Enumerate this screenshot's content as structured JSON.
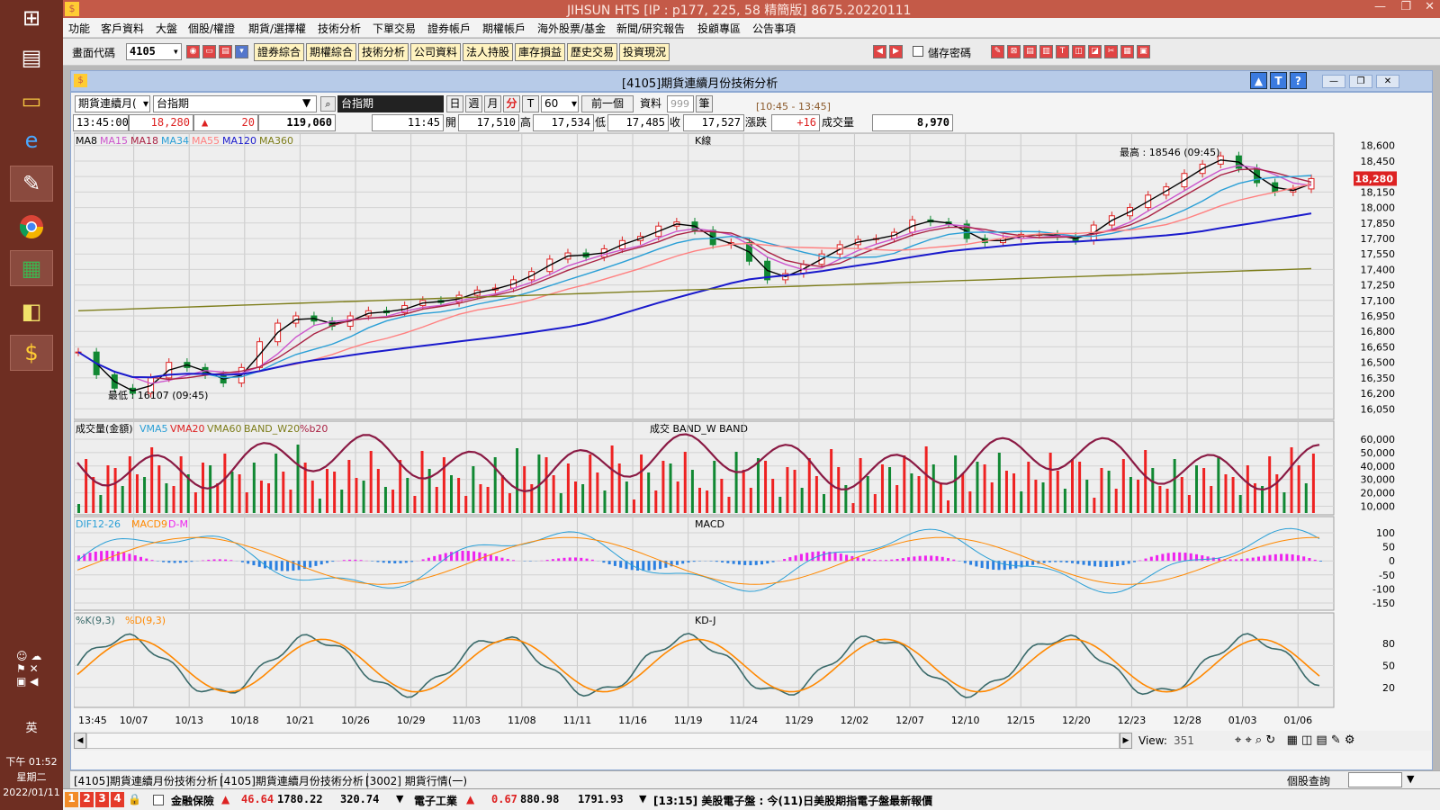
{
  "window_title": "JIHSUN HTS [IP : p177, 225, 58 精簡版] 8675.20220111",
  "taskbar": {
    "icons": [
      "windows-icon",
      "app-icon-1",
      "explorer-icon",
      "ie-icon",
      "paint-icon",
      "chrome-icon",
      "excel-icon",
      "sticky-icon",
      "jihsun-icon"
    ],
    "ime": "英",
    "time": "下午 01:52",
    "weekday": "星期二",
    "date": "2022/01/11"
  },
  "menu": [
    "功能",
    "客戶資料",
    "大盤",
    "個股/權證",
    "期貨/選擇權",
    "技術分析",
    "下單交易",
    "證券帳戶",
    "期權帳戶",
    "海外股票/基金",
    "新聞/研究報告",
    "投顧專區",
    "公告事項"
  ],
  "toolbar": {
    "code_label": "畫面代碼",
    "code_value": "4105",
    "buttons": [
      "證券綜合",
      "期權綜合",
      "技術分析",
      "公司資料",
      "法人持股",
      "庫存損益",
      "歷史交易",
      "投資現況"
    ],
    "save_password": "儲存密碼"
  },
  "child_window": {
    "title": "[4105]期貨連續月份技術分析",
    "dropdown_type": "期貨連續月(",
    "symbol": "台指期",
    "symbol_name": "台指期",
    "period_buttons": [
      "日",
      "週",
      "月",
      "分",
      "T"
    ],
    "minutes": "60",
    "prev": "前一個",
    "data_label": "資料",
    "data_count": "999",
    "data_unit": "筆",
    "session": "[10:45 - 13:45]"
  },
  "quote": {
    "time": "13:45:00",
    "price": "18,280",
    "change": "20",
    "volume_total": "119,060",
    "bar_time": "11:45",
    "open_label": "開",
    "open": "17,510",
    "high_label": "高",
    "high": "17,534",
    "low_label": "低",
    "low": "17,485",
    "close_label": "收",
    "close": "17,527",
    "chg_label": "漲跌",
    "chg": "+16",
    "vol_label": "成交量",
    "vol": "8,970"
  },
  "chart_data": {
    "type": "line",
    "panels": [
      "K線",
      "成交 BAND_W BAND",
      "MACD",
      "KD-J"
    ],
    "k_legend": [
      "MA8",
      "MA15",
      "MA18",
      "MA34",
      "MA55",
      "MA120",
      "MA360"
    ],
    "k_legend_colors": [
      "#000000",
      "#cc55cc",
      "#aa2244",
      "#2a9fd6",
      "#ff8080",
      "#1a1acc",
      "#7d7d1a"
    ],
    "high_annotation": "最高 : 18546 (09:45)",
    "low_annotation": "最低 : 16107 (09:45)",
    "price_ylim": [
      16000,
      18650
    ],
    "price_ticks": [
      "18,600",
      "18,450",
      "18,300",
      "18,150",
      "18,000",
      "17,850",
      "17,700",
      "17,550",
      "17,400",
      "17,250",
      "17,100",
      "16,950",
      "16,800",
      "16,650",
      "16,500",
      "16,350",
      "16,200",
      "16,050"
    ],
    "last_price": "18,280",
    "vol_legend": [
      "成交量(金額)",
      "VMA5",
      "VMA20",
      "VMA60",
      "BAND_W20",
      "%b20"
    ],
    "vol_legend_colors": [
      "#000000",
      "#2a9fd6",
      "#dd2222",
      "#7d7d1a",
      "#7d7d1a",
      "#aa2244"
    ],
    "vol_ticks": [
      "60,000",
      "50,000",
      "40,000",
      "30,000",
      "20,000",
      "10,000"
    ],
    "macd_legend": [
      "DIF12-26",
      "MACD9",
      "D-M"
    ],
    "macd_legend_colors": [
      "#2a9fd6",
      "#ff8800",
      "#ee22ee"
    ],
    "macd_ticks": [
      "100",
      "50",
      "0",
      "-50",
      "-100",
      "-150"
    ],
    "kd_legend": [
      "%K(9,3)",
      "%D(9,3)"
    ],
    "kd_legend_colors": [
      "#3a6a6a",
      "#ff8800"
    ],
    "kd_ticks": [
      "80",
      "50",
      "20"
    ],
    "x_ticks": [
      "13:45",
      "10/07",
      "10/13",
      "10/18",
      "10/21",
      "10/26",
      "10/29",
      "11/03",
      "11/08",
      "11/11",
      "11/16",
      "11/19",
      "11/24",
      "11/29",
      "12/02",
      "12/07",
      "12/10",
      "12/15",
      "12/20",
      "12/23",
      "12/28",
      "01/03",
      "01/06"
    ],
    "close_series": [
      16600,
      16380,
      16250,
      16200,
      16350,
      16500,
      16450,
      16380,
      16300,
      16450,
      16700,
      16880,
      16950,
      16900,
      16850,
      16950,
      17000,
      16980,
      17050,
      17100,
      17080,
      17150,
      17200,
      17220,
      17300,
      17380,
      17500,
      17560,
      17520,
      17600,
      17680,
      17720,
      17820,
      17860,
      17780,
      17640,
      17660,
      17480,
      17300,
      17360,
      17450,
      17550,
      17640,
      17690,
      17700,
      17760,
      17880,
      17860,
      17840,
      17700,
      17660,
      17700,
      17740,
      17740,
      17720,
      17680,
      17830,
      17920,
      18000,
      18120,
      18200,
      18330,
      18420,
      18500,
      18380,
      18240,
      18150,
      18180,
      18280
    ]
  },
  "scroll": {
    "view_label": "View:",
    "view": "351"
  },
  "status_tabs": [
    "[4105]期貨連續月份技術分析",
    "[4105]期貨連續月份技術分析",
    "[3002] 期貨行情(一)"
  ],
  "status_right": "個股查詢",
  "ticker": {
    "pages": [
      "1",
      "2",
      "3",
      "4"
    ],
    "item1_name": "金融保險",
    "item1_chg": "46.64",
    "item1_val": "1780.22",
    "item1_vol": "320.74",
    "item2_name": "電子工業",
    "item2_chg": "0.67",
    "item2_val": "880.98",
    "item2_vol": "1791.93",
    "news": "[13:15] 美股電子盤 : 今(11)日美股期指電子盤最新報價"
  }
}
